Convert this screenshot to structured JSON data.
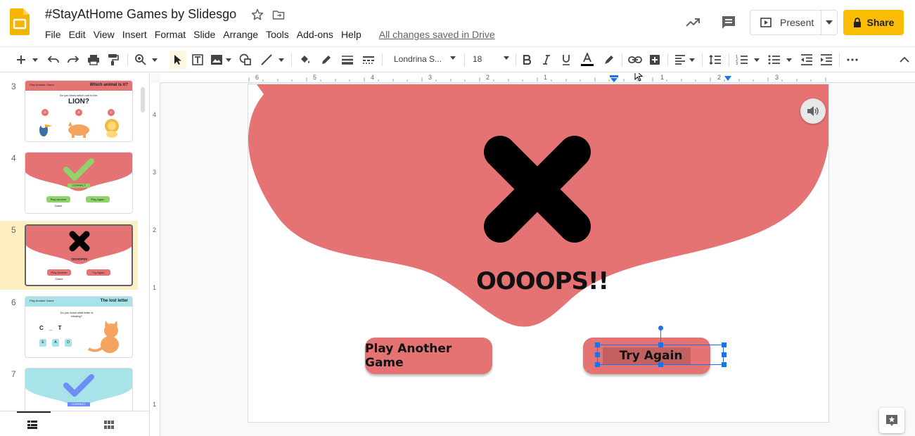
{
  "header": {
    "title": "#StayAtHome Games by Slidesgo",
    "menu": [
      "File",
      "Edit",
      "View",
      "Insert",
      "Format",
      "Slide",
      "Arrange",
      "Tools",
      "Add-ons",
      "Help"
    ],
    "save_status": "All changes saved in Drive",
    "present_label": "Present",
    "share_label": "Share"
  },
  "toolbar": {
    "font_name": "Londrina S...",
    "font_size": "18"
  },
  "filmstrip": {
    "slides": [
      {
        "num": "3",
        "selected": false,
        "banner": "Play Another Game",
        "title_right": "Which animal is it?",
        "question": "Do you know which one is the:",
        "word": "LION?",
        "options": [
          "A",
          "B",
          "C"
        ]
      },
      {
        "num": "4",
        "selected": false,
        "label": "CORRECT",
        "buttons": [
          "Play Another Game",
          "Play Again"
        ]
      },
      {
        "num": "5",
        "selected": true,
        "label": "OOOOPS!!",
        "buttons": [
          "Play Another Game",
          "Try Again"
        ]
      },
      {
        "num": "6",
        "selected": false,
        "banner": "Play Another Game",
        "title_right": "The lost letter",
        "question": "Do you know what letter is missing?",
        "word": "C _ T",
        "options": [
          "E",
          "A",
          "D"
        ]
      },
      {
        "num": "7",
        "selected": false,
        "label": "CORRECT"
      }
    ]
  },
  "ruler": {
    "h_numbers": [
      "6",
      "5",
      "4",
      "3",
      "2",
      "1",
      "1",
      "2",
      "3"
    ],
    "v_numbers": [
      "4",
      "3",
      "2",
      "1",
      "1"
    ]
  },
  "slide": {
    "headline": "OOOOPS!!",
    "button_left": "Play Another Game",
    "button_right": "Try Again"
  },
  "colors": {
    "accent_red": "#e57373",
    "share_yellow": "#fbbc04",
    "selection_blue": "#1a73e8"
  }
}
